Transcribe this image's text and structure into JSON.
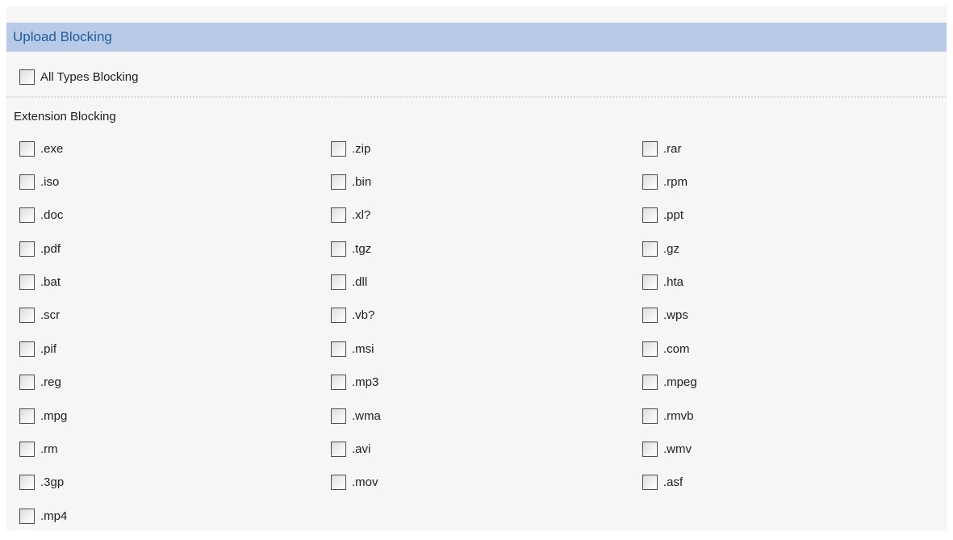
{
  "section": {
    "title": "Upload Blocking"
  },
  "all_types": {
    "label": "All Types Blocking"
  },
  "extension": {
    "heading": "Extension Blocking",
    "items": [
      ".exe",
      ".zip",
      ".rar",
      ".iso",
      ".bin",
      ".rpm",
      ".doc",
      ".xl?",
      ".ppt",
      ".pdf",
      ".tgz",
      ".gz",
      ".bat",
      ".dll",
      ".hta",
      ".scr",
      ".vb?",
      ".wps",
      ".pif",
      ".msi",
      ".com",
      ".reg",
      ".mp3",
      ".mpeg",
      ".mpg",
      ".wma",
      ".rmvb",
      ".rm",
      ".avi",
      ".wmv",
      ".3gp",
      ".mov",
      ".asf",
      ".mp4"
    ]
  }
}
